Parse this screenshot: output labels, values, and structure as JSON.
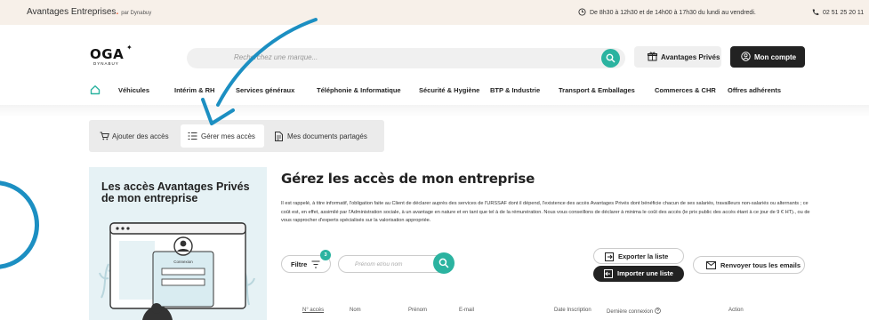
{
  "topbar": {
    "brand": "Avantages Entreprises",
    "brand_dot": ".",
    "brand_by": "par Dynabuy",
    "hours": "De 8h30 à 12h30 et de 14h00 à 17h30 du lundi au vendredi.",
    "phone": "02 51 25 20 11"
  },
  "header": {
    "logo_text": "OGA",
    "logo_sub": "DYNABUY",
    "search_placeholder": "Recherchez une marque...",
    "privileges_button": "Avantages Privés",
    "account_button": "Mon compte"
  },
  "nav": {
    "items": [
      "Véhicules",
      "Intérim & RH",
      "Services généraux",
      "Téléphonie & Informatique",
      "Sécurité & Hygiène",
      "BTP & Industrie",
      "Transport & Emballages",
      "Commerces & CHR",
      "Offres adhérents"
    ]
  },
  "tabs": {
    "items": [
      "Ajouter des accès",
      "Gérer mes accès",
      "Mes documents partagés"
    ],
    "active_index": 1
  },
  "promo": {
    "title": "Les accès Avantages Privés de mon entreprise",
    "login_label": "Connexion"
  },
  "main": {
    "title": "Gérez les accès de mon entreprise",
    "paragraph": "Il est rappelé, à titre informatif, l'obligation faite au Client de déclarer auprès des services de l'URSSAF dont il dépend, l'existence des accès Avantages Privés dont bénéficie chacun de ses salariés, travailleurs non-salariés ou alternants ; ce coût est, en effet, assimilé par l'Administration sociale, à un avantage en nature et en tant que tel à de la rémunération. Nous vous conseillons de déclarer à minima le coût des accès (le prix public des accès étant à ce jour de 9 € HT)., ou de vous rapprocher d'experts spécialisés sur la valorisation appropriée.",
    "filter_label": "Filtre",
    "filter_count": "3",
    "name_placeholder": "Prénom et/ou nom",
    "export_button": "Exporter la liste",
    "import_button": "Importer une liste",
    "resend_button": "Renvoyer tous les emails",
    "columns": [
      "N° accès",
      "Nom",
      "Prénom",
      "E-mail",
      "Date Inscription",
      "Dernière connexion",
      "Action"
    ]
  },
  "colors": {
    "accent_teal": "#2bb3a0",
    "annotation_blue": "#1c8fc2",
    "dark": "#222222",
    "topbar_bg": "#f7f0e9",
    "card_bg": "#e6f2f5"
  },
  "icons": [
    "clock-icon",
    "phone-icon",
    "search-icon",
    "gift-icon",
    "user-circle-icon",
    "home-icon",
    "cart-icon",
    "list-icon",
    "document-icon",
    "filter-icon",
    "export-icon",
    "import-icon",
    "mail-icon",
    "help-icon"
  ]
}
